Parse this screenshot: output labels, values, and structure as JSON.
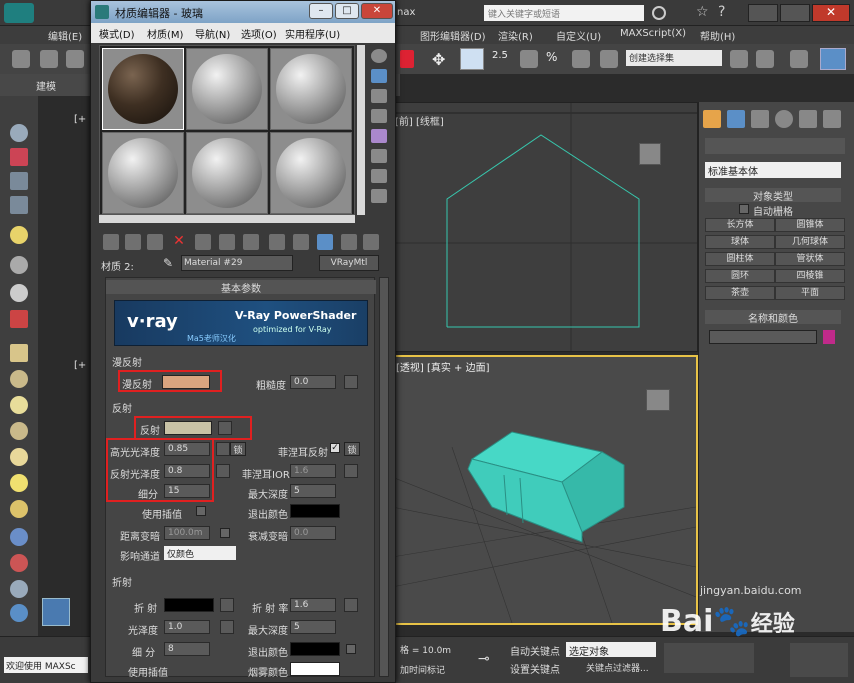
{
  "app": {
    "title_fragment": "nax",
    "search_placeholder": "键入关键字或短语",
    "menu": [
      "编辑(E)",
      "图形编辑器(D)",
      "渲染(R)",
      "自定义(U)",
      "MAXScript(X)",
      "帮助(H)"
    ],
    "selection_set": "创建选择集",
    "ribbon_tab": "建模"
  },
  "viewports": {
    "top_label": "[前] [线框]",
    "persp_label": "[透视] [真实 + 边面]",
    "left_top_label": "[+",
    "left_mid_label": "[+"
  },
  "command_panel": {
    "dropdown": "标准基本体",
    "object_type_title": "对象类型",
    "autogrid": "自动栅格",
    "buttons": [
      "长方体",
      "圆锥体",
      "球体",
      "几何球体",
      "圆柱体",
      "管状体",
      "圆环",
      "四棱锥",
      "茶壶",
      "平面"
    ],
    "name_color_title": "名称和颜色"
  },
  "status": {
    "welcome": "欢迎使用 MAXSc",
    "grid": "格 = 10.0m",
    "add_time_tag": "加时间标记",
    "auto_key": "自动关键点",
    "set_key": "设置关键点",
    "select_obj": "选定对象",
    "key_filter": "关键点过滤器..."
  },
  "material_editor": {
    "title": "材质编辑器 - 玻璃",
    "menu": [
      "模式(D)",
      "材质(M)",
      "导航(N)",
      "选项(O)",
      "实用程序(U)"
    ],
    "material_label": "材质 2:",
    "material_name": "Material #29",
    "material_type": "VRayMtl",
    "basic_params": "基本参数",
    "banner": {
      "logo": "v·ray",
      "title": "V-Ray PowerShader",
      "subtitle": "optimized for V-Ray",
      "credit": "Ma5老师汉化"
    },
    "diffuse": {
      "group": "漫反射",
      "label": "漫反射",
      "roughness_label": "粗糙度",
      "roughness": "0.0",
      "color": "#d9a47f"
    },
    "reflection": {
      "group": "反射",
      "label": "反射",
      "color": "#c8c2a6",
      "hilight_gloss_label": "高光光泽度",
      "hilight_gloss": "0.85",
      "lock": "锁",
      "fresnel_label": "菲涅耳反射",
      "fresnel_lock": "锁",
      "refl_gloss_label": "反射光泽度",
      "refl_gloss": "0.8",
      "fresnel_ior_label": "菲涅耳IOR",
      "fresnel_ior": "1.6",
      "subdivs_label": "细分",
      "subdivs": "15",
      "max_depth_label": "最大深度",
      "max_depth": "5",
      "use_interp_label": "使用插值",
      "exit_color_label": "退出颜色",
      "dim_dist_label": "距离变暗",
      "dim_dist": "100.0m",
      "dim_falloff_label": "衰减变暗",
      "dim_falloff": "0.0",
      "affect_channels_label": "影响通道",
      "affect_channels": "仅颜色"
    },
    "refraction": {
      "group": "折射",
      "label": "折 射",
      "ior_label": "折 射 率",
      "ior": "1.6",
      "gloss_label": "光泽度",
      "gloss": "1.0",
      "max_depth_label": "最大深度",
      "max_depth": "5",
      "subdivs_label": "细 分",
      "subdivs": "8",
      "exit_color_label": "退出颜色",
      "use_interp_label": "使用插值",
      "fog_color_label": "烟雾颜色"
    }
  },
  "watermark": {
    "brand": "Bai",
    "brand_tail": "经验",
    "url": "jingyan.baidu.com"
  }
}
